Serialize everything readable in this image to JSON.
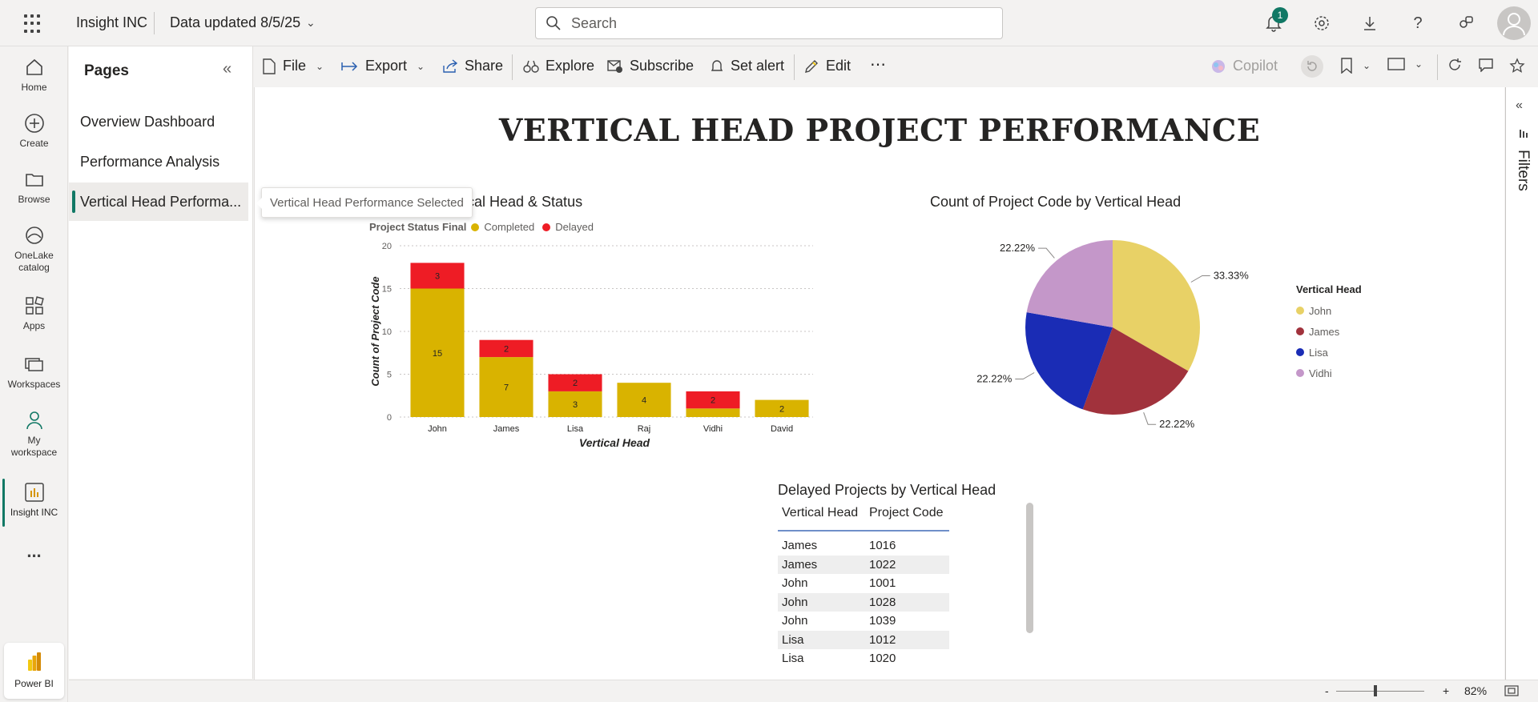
{
  "topbar": {
    "app_name": "Insight INC",
    "data_updated": "Data updated 8/5/25",
    "search_placeholder": "Search",
    "notification_count": "1"
  },
  "rail": {
    "items": [
      {
        "label": "Home",
        "icon": "home-icon"
      },
      {
        "label": "Create",
        "icon": "create-icon"
      },
      {
        "label": "Browse",
        "icon": "browse-icon"
      },
      {
        "label": "OneLake catalog",
        "icon": "onelake-icon"
      },
      {
        "label": "Apps",
        "icon": "apps-icon"
      },
      {
        "label": "Workspaces",
        "icon": "workspaces-icon"
      },
      {
        "label": "My workspace",
        "icon": "my-workspace-icon"
      },
      {
        "label": "Insight INC",
        "icon": "report-icon"
      }
    ],
    "more": "...",
    "brand": "Power BI"
  },
  "pages": {
    "title": "Pages",
    "items": [
      {
        "label": "Overview Dashboard"
      },
      {
        "label": "Performance Analysis"
      },
      {
        "label": "Vertical Head Performa..."
      }
    ],
    "tooltip": "Vertical Head Performance Selected"
  },
  "toolbar": {
    "file": "File",
    "export": "Export",
    "share": "Share",
    "explore": "Explore",
    "subscribe": "Subscribe",
    "set_alert": "Set alert",
    "edit": "Edit",
    "copilot": "Copilot"
  },
  "report": {
    "title": "VERTICAL HEAD PROJECT PERFORMANCE",
    "filters_label": "Filters"
  },
  "bar_visual": {
    "title_visible": "rtical Head & Status",
    "legend_title": "Project Status Final",
    "legend": [
      {
        "name": "Completed",
        "color": "#d9b300"
      },
      {
        "name": "Delayed",
        "color": "#ee1c25"
      }
    ]
  },
  "pie_visual": {
    "title": "Count of Project Code by Vertical Head",
    "legend_title": "Vertical Head",
    "legend": [
      {
        "name": "John",
        "color": "#e8d166"
      },
      {
        "name": "James",
        "color": "#a1323c"
      },
      {
        "name": "Lisa",
        "color": "#1a2cb5"
      },
      {
        "name": "Vidhi",
        "color": "#c497c9"
      }
    ]
  },
  "table_visual": {
    "title": "Delayed Projects by Vertical Head",
    "columns": [
      "Vertical Head",
      "Project Code"
    ],
    "rows": [
      [
        "James",
        "1016"
      ],
      [
        "James",
        "1022"
      ],
      [
        "John",
        "1001"
      ],
      [
        "John",
        "1028"
      ],
      [
        "John",
        "1039"
      ],
      [
        "Lisa",
        "1012"
      ],
      [
        "Lisa",
        "1020"
      ]
    ]
  },
  "statusbar": {
    "zoom_minus": "-",
    "zoom_plus": "+",
    "zoom_level": "82%"
  },
  "chart_data": [
    {
      "type": "bar",
      "stacked": true,
      "title": "",
      "categories": [
        "John",
        "James",
        "Lisa",
        "Raj",
        "Vidhi",
        "David"
      ],
      "series": [
        {
          "name": "Completed",
          "values": [
            15,
            7,
            3,
            4,
            1,
            2
          ],
          "labels": [
            "15",
            "7",
            "3",
            "4",
            "",
            "2"
          ],
          "color": "#d9b300"
        },
        {
          "name": "Delayed",
          "values": [
            3,
            2,
            2,
            0,
            2,
            0
          ],
          "labels": [
            "3",
            "2",
            "2",
            "",
            "2",
            ""
          ],
          "color": "#ee1c25"
        }
      ],
      "xlabel": "Vertical Head",
      "ylabel": "Count of Project Code",
      "ylim": [
        0,
        20
      ],
      "yticks": [
        0,
        5,
        10,
        15,
        20
      ],
      "grid": true
    },
    {
      "type": "pie",
      "title": "Count of Project Code by Vertical Head",
      "slices": [
        {
          "name": "John",
          "value": 33.33,
          "label": "33.33%",
          "color": "#e8d166"
        },
        {
          "name": "James",
          "value": 22.22,
          "label": "22.22%",
          "color": "#a1323c"
        },
        {
          "name": "Lisa",
          "value": 22.22,
          "label": "22.22%",
          "color": "#1a2cb5"
        },
        {
          "name": "Vidhi",
          "value": 22.22,
          "label": "22.22%",
          "color": "#c497c9"
        }
      ],
      "legend_position": "right"
    }
  ]
}
